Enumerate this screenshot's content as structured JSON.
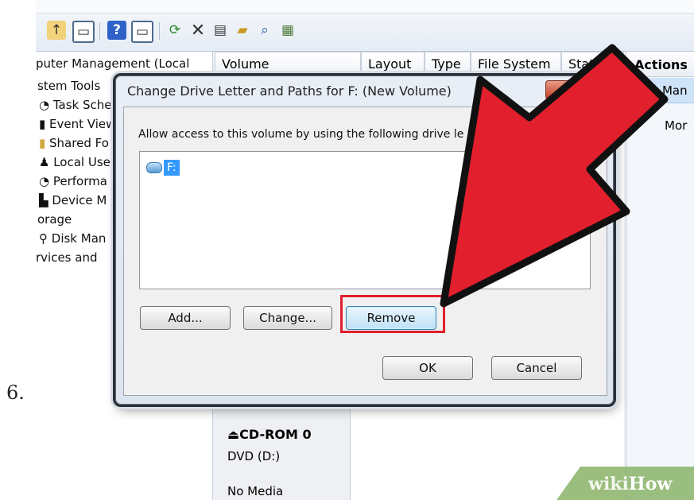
{
  "step_number": "6.",
  "toolbar": {
    "icons": [
      "folder-up-icon",
      "show-pane-icon",
      "help-icon",
      "pane-icon",
      "refresh-icon",
      "delete-icon",
      "properties-icon",
      "open-folder-icon",
      "search-icon",
      "disk-icon"
    ],
    "delete_glyph": "✕"
  },
  "tree": {
    "items": [
      {
        "label": "puter Management (Local"
      },
      {
        "label": "stem Tools"
      },
      {
        "label": "Task Sche"
      },
      {
        "label": "Event View"
      },
      {
        "label": "Shared Fo"
      },
      {
        "label": "Local Use"
      },
      {
        "label": "Performa"
      },
      {
        "label": "Device M"
      },
      {
        "label": "orage"
      },
      {
        "label": "Disk Man"
      },
      {
        "label": "rvices and"
      }
    ]
  },
  "volume_pane": {
    "columns": [
      "Volume",
      "Layout",
      "Type",
      "File System",
      "Status"
    ],
    "disk": {
      "name": "CD-ROM 0",
      "drive": "DVD (D:)",
      "media": "No Media"
    }
  },
  "actions": {
    "header": "Actions",
    "selected": "Disk Man",
    "more": "Mor"
  },
  "dialog": {
    "title": "Change Drive Letter and Paths for F: (New Volume)",
    "close_glyph": "X",
    "label": "Allow access to this volume by using the following drive le",
    "list_items": [
      "F:"
    ],
    "buttons": {
      "add": "Add...",
      "change": "Change...",
      "remove": "Remove",
      "ok": "OK",
      "cancel": "Cancel"
    }
  },
  "annotation": {
    "arrow_color": "#e21f2d",
    "highlight_color": "#e0202e"
  },
  "watermark": {
    "prefix": "wiki",
    "suffix": "How"
  }
}
